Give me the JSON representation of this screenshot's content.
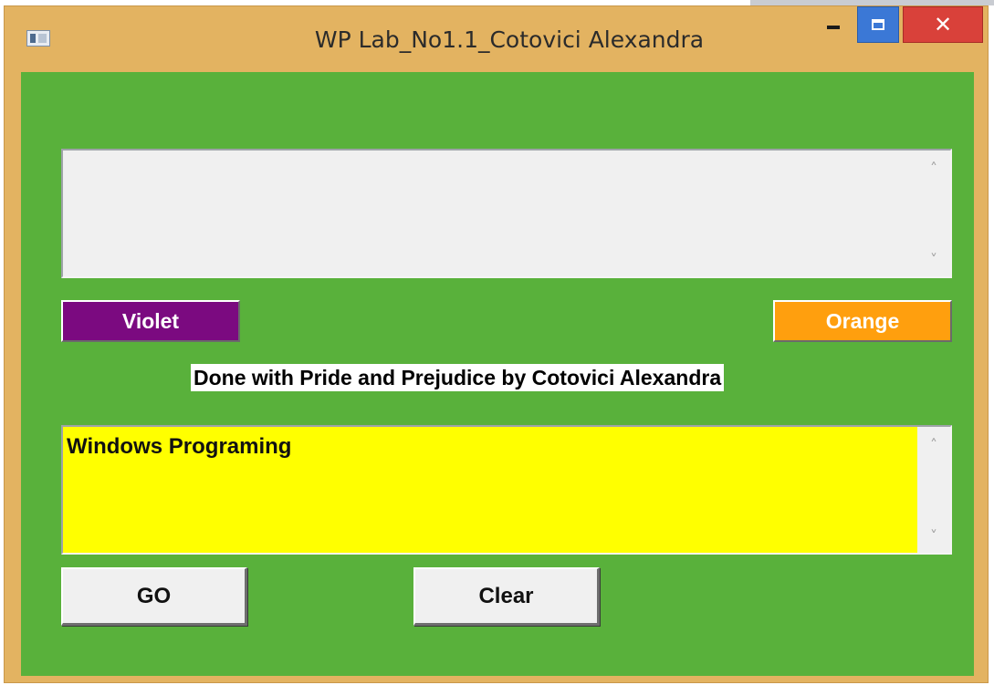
{
  "window": {
    "title": "WP Lab_No1.1_Cotovici Alexandra",
    "controls": {
      "minimize_icon": "minimize-icon",
      "maximize_icon": "maximize-icon",
      "close_glyph": "✕"
    }
  },
  "top_textbox": {
    "value": ""
  },
  "color_buttons": {
    "violet": {
      "label": "Violet",
      "color": "#7b0a80"
    },
    "orange": {
      "label": "Orange",
      "color": "#ff9f0e"
    }
  },
  "caption": "Done with Pride and Prejudice by Cotovici Alexandra",
  "bottom_textbox": {
    "value": "Windows Programing",
    "background": "#ffff00"
  },
  "buttons": {
    "go_label": "GO",
    "clear_label": "Clear"
  },
  "scroll_arrows": {
    "up": "˄",
    "down": "˅"
  },
  "colors": {
    "client_background": "#59b13b",
    "frame": "#e3b361"
  }
}
